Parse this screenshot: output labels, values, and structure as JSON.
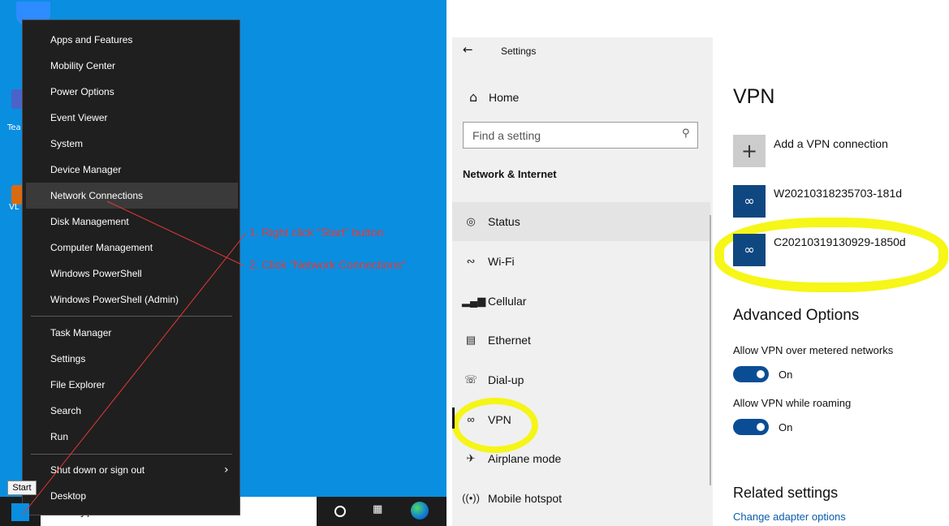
{
  "desktop": {
    "icons": [
      {
        "label": "Tea"
      },
      {
        "label": "VL"
      }
    ],
    "taskbar": {
      "search_placeholder": "Type here to search",
      "cortana_icon": "circle-icon",
      "taskview_icon": "task-view-icon",
      "edge_icon": "edge-icon"
    },
    "start_tooltip": "Start"
  },
  "winx_menu": {
    "group1": [
      {
        "label": "Apps and Features"
      },
      {
        "label": "Mobility Center"
      },
      {
        "label": "Power Options"
      },
      {
        "label": "Event Viewer"
      },
      {
        "label": "System"
      },
      {
        "label": "Device Manager"
      },
      {
        "label": "Network Connections"
      },
      {
        "label": "Disk Management"
      },
      {
        "label": "Computer Management"
      },
      {
        "label": "Windows PowerShell"
      },
      {
        "label": "Windows PowerShell (Admin)"
      }
    ],
    "group2": [
      {
        "label": "Task Manager"
      },
      {
        "label": "Settings"
      },
      {
        "label": "File Explorer"
      },
      {
        "label": "Search"
      },
      {
        "label": "Run"
      }
    ],
    "group3": [
      {
        "label": "Shut down or sign out"
      },
      {
        "label": "Desktop"
      }
    ],
    "highlighted": "Network Connections"
  },
  "annotations": {
    "step1": "1. Right click \"Start\" button",
    "step2": "2. Click \"Network Connections\"",
    "color": "#e53935"
  },
  "settings": {
    "back_icon": "back-arrow-icon",
    "window_title": "Settings",
    "home_label": "Home",
    "search_placeholder": "Find a setting",
    "section_title": "Network & Internet",
    "nav": [
      {
        "label": "Status",
        "icon": "globe-icon"
      },
      {
        "label": "Wi-Fi",
        "icon": "wifi-icon"
      },
      {
        "label": "Cellular",
        "icon": "cellular-icon"
      },
      {
        "label": "Ethernet",
        "icon": "ethernet-icon"
      },
      {
        "label": "Dial-up",
        "icon": "dialup-icon"
      },
      {
        "label": "VPN",
        "icon": "vpn-icon"
      },
      {
        "label": "Airplane mode",
        "icon": "airplane-icon"
      },
      {
        "label": "Mobile hotspot",
        "icon": "hotspot-icon"
      }
    ],
    "selected": "VPN"
  },
  "vpn_page": {
    "title": "VPN",
    "add_label": "Add a VPN connection",
    "connections": [
      {
        "name": "W20210318235703-181d"
      },
      {
        "name": "C20210319130929-1850d"
      }
    ],
    "advanced_title": "Advanced Options",
    "opt_metered_label": "Allow VPN over metered networks",
    "opt_metered_state": "On",
    "opt_roaming_label": "Allow VPN while roaming",
    "opt_roaming_state": "On",
    "related_title": "Related settings",
    "change_adapter_link": "Change adapter options",
    "accent_color": "#0b4d95",
    "highlight_color": "#f5f500"
  }
}
